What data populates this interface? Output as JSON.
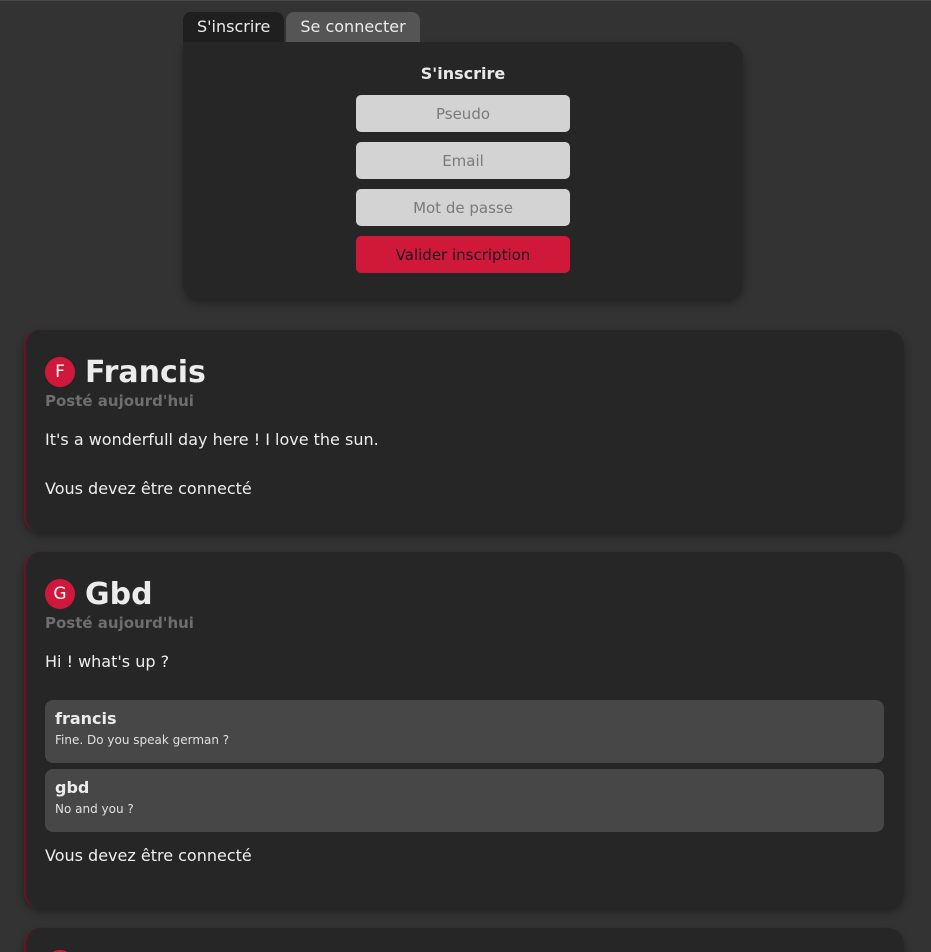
{
  "auth": {
    "tabs": [
      {
        "label": "S'inscrire",
        "active": true
      },
      {
        "label": "Se connecter",
        "active": false
      }
    ],
    "title": "S'inscrire",
    "fields": {
      "pseudo_placeholder": "Pseudo",
      "email_placeholder": "Email",
      "password_placeholder": "Mot de passe"
    },
    "submit_label": "Valider inscription"
  },
  "colors": {
    "accent": "#d0183a",
    "background": "#333333",
    "card": "#262626"
  },
  "posts": [
    {
      "initial": "F",
      "author": "Francis",
      "date": "Posté aujourd'hui",
      "text": "It's a wonderfull day here ! I love the sun.",
      "comments": [],
      "notice": "Vous devez être connecté"
    },
    {
      "initial": "G",
      "author": "Gbd",
      "date": "Posté aujourd'hui",
      "text": "Hi ! what's up ?",
      "comments": [
        {
          "author": "francis",
          "text": "Fine. Do you speak german ?"
        },
        {
          "author": "gbd",
          "text": "No and you ?"
        }
      ],
      "notice": "Vous devez être connecté"
    }
  ]
}
